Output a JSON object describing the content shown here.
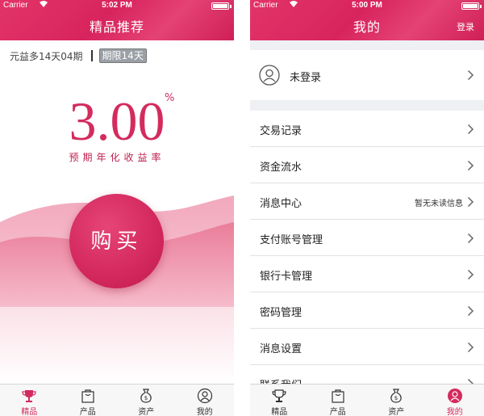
{
  "status": {
    "carrier": "Carrier",
    "time": "5:02 PM"
  },
  "status2": {
    "carrier": "Carrier",
    "time": "5:00 PM"
  },
  "screen1": {
    "title": "精品推荐",
    "term_text": "元益多14天04期",
    "term_badge": "期限14天",
    "rate_value": "3.00",
    "rate_sign": "%",
    "rate_label": "预期年化收益率",
    "buy_label": "购买"
  },
  "screen2": {
    "title": "我的",
    "login_label": "登录",
    "profile_label": "未登录",
    "menu": [
      {
        "label": "交易记录",
        "note": ""
      },
      {
        "label": "资金流水",
        "note": ""
      },
      {
        "label": "消息中心",
        "note": "暂无未读信息"
      },
      {
        "label": "支付账号管理",
        "note": ""
      },
      {
        "label": "银行卡管理",
        "note": ""
      },
      {
        "label": "密码管理",
        "note": ""
      },
      {
        "label": "消息设置",
        "note": ""
      },
      {
        "label": "联系我们",
        "note": ""
      }
    ]
  },
  "tabs": [
    {
      "label": "精品",
      "icon": "trophy-icon"
    },
    {
      "label": "产品",
      "icon": "bag-icon"
    },
    {
      "label": "资产",
      "icon": "money-bag-icon"
    },
    {
      "label": "我的",
      "icon": "person-icon"
    }
  ],
  "colors": {
    "accent": "#d42b5e",
    "nav": "#e23468",
    "inactive_tab": "#333333"
  }
}
